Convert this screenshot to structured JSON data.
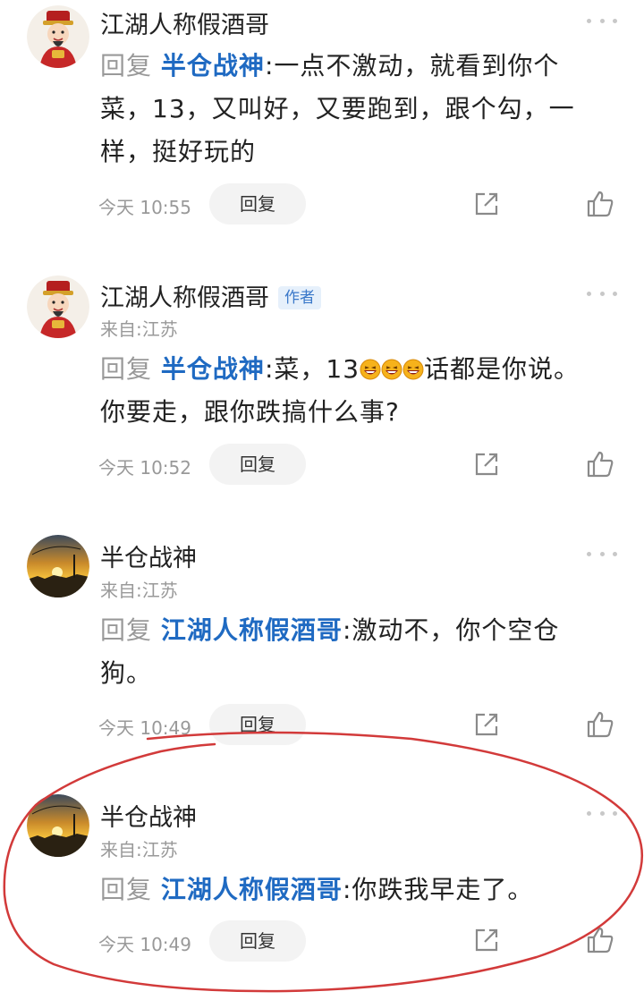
{
  "comments": [
    {
      "username": "江湖人称假酒哥",
      "badge": "",
      "location": "",
      "reply_prefix": "回复",
      "mention": "半仓战神",
      "colon": ":",
      "text": "一点不激动，就看到你个菜，13，又叫好，又要跑到，跟个勾，一样，挺好玩的",
      "time": "今天 10:55",
      "reply_label": "回复",
      "avatar": "caishen-avatar"
    },
    {
      "username": "江湖人称假酒哥",
      "badge": "作者",
      "location": "来自:江苏",
      "reply_prefix": "回复",
      "mention": "半仓战神",
      "colon": ":",
      "text_before": "菜，13",
      "emoji": "laughing-emoji",
      "text_after": "话都是你说。你要走，跟你跌搞什么事?",
      "time": "今天 10:52",
      "reply_label": "回复",
      "avatar": "caishen-avatar"
    },
    {
      "username": "半仓战神",
      "badge": "",
      "location": "来自:江苏",
      "reply_prefix": "回复",
      "mention": "江湖人称假酒哥",
      "colon": ":",
      "text": "激动不，你个空仓狗。",
      "time": "今天 10:49",
      "reply_label": "回复",
      "avatar": "sunset-avatar"
    },
    {
      "username": "半仓战神",
      "badge": "",
      "location": "来自:江苏",
      "reply_prefix": "回复",
      "mention": "江湖人称假酒哥",
      "colon": ":",
      "text": "你跌我早走了。",
      "time": "今天 10:49",
      "reply_label": "回复",
      "avatar": "sunset-avatar"
    }
  ],
  "icons": {
    "more": "more-dots-icon",
    "share": "share-icon",
    "like": "thumbs-up-icon"
  },
  "colors": {
    "mention": "#1f6ac2",
    "annotation": "#d23a3a"
  }
}
